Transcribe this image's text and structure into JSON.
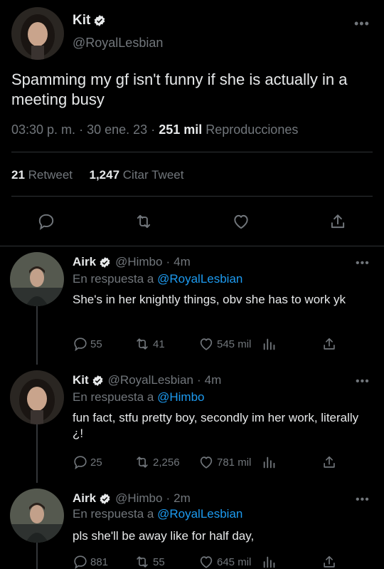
{
  "main_tweet": {
    "author_name": "Kit",
    "author_handle": "@RoyalLesbian",
    "text": "Spamming my gf isn't funny if she is actually in a meeting busy",
    "time": "03:30 p. m.",
    "separator": "·",
    "date": "30 ene. 23",
    "views_count": "251 mil",
    "views_label": "Reproducciones",
    "retweets_count": "21",
    "retweets_label": "Retweet",
    "quotes_count": "1,247",
    "quotes_label": "Citar Tweet",
    "icons": [
      "reply-icon",
      "retweet-icon",
      "like-icon",
      "share-icon"
    ]
  },
  "replies": [
    {
      "author_name": "Airk",
      "author_handle": "@Himbo",
      "separator": "·",
      "time_ago": "4m",
      "replying_prefix": "En respuesta a",
      "replying_to": "@RoyalLesbian",
      "text": "She's in her knightly things, obv she has to work yk",
      "reply_count": "55",
      "retweet_count": "41",
      "like_count": "545 mil"
    },
    {
      "author_name": "Kit",
      "author_handle": "@RoyalLesbian",
      "separator": "·",
      "time_ago": "4m",
      "replying_prefix": "En respuesta a",
      "replying_to": "@Himbo",
      "text": "fun fact, stfu pretty boy, secondly im her work, literally ¿!",
      "reply_count": "25",
      "retweet_count": "2,256",
      "like_count": "781 mil"
    },
    {
      "author_name": "Airk",
      "author_handle": "@Himbo",
      "separator": "·",
      "time_ago": "2m",
      "replying_prefix": "En respuesta a",
      "replying_to": "@RoyalLesbian",
      "text": "pls she'll be away like for half day,",
      "reply_count": "881",
      "retweet_count": "55",
      "like_count": "645 mil"
    }
  ],
  "colors": {
    "background": "#000000",
    "text": "#e7e9ea",
    "secondary": "#71767b",
    "link": "#1d9bf0",
    "divider": "#2f3336"
  }
}
